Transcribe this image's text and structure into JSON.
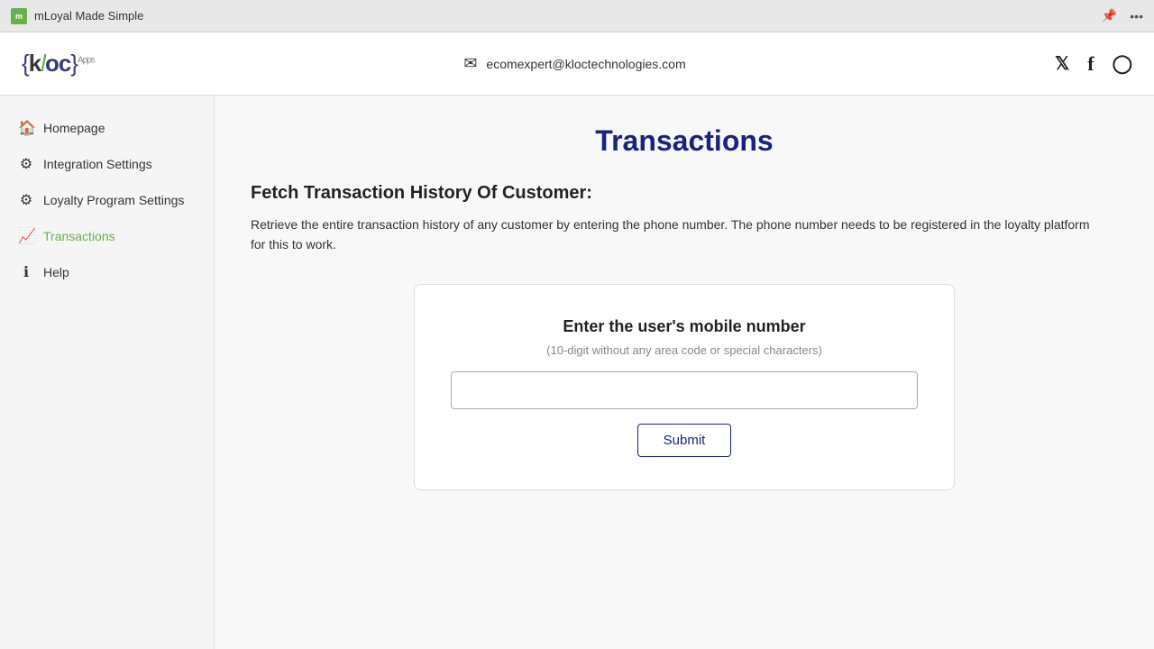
{
  "browser": {
    "tab_title": "mLoyal Made Simple",
    "pin_icon": "📌",
    "more_icon": "⋯"
  },
  "header": {
    "logo_text": "{kloc}",
    "logo_subtitle": "Apps",
    "email_address": "ecomexpert@kloctechnologies.com",
    "social": {
      "twitter": "𝕏",
      "facebook": "f",
      "instagram": "⊙"
    }
  },
  "sidebar": {
    "items": [
      {
        "id": "homepage",
        "label": "Homepage",
        "icon": "🏠",
        "active": false
      },
      {
        "id": "integration-settings",
        "label": "Integration Settings",
        "icon": "⚙",
        "active": false
      },
      {
        "id": "loyalty-program-settings",
        "label": "Loyalty Program Settings",
        "icon": "⚙",
        "active": false
      },
      {
        "id": "transactions",
        "label": "Transactions",
        "icon": "📊",
        "active": true
      },
      {
        "id": "help",
        "label": "Help",
        "icon": "ℹ",
        "active": false
      }
    ]
  },
  "main": {
    "page_title": "Transactions",
    "section_title": "Fetch Transaction History Of Customer:",
    "section_desc": "Retrieve the entire transaction history of any customer by entering the phone number. The phone number needs to be registered in the loyalty platform for this to work.",
    "card": {
      "title": "Enter the user's mobile number",
      "subtitle": "(10-digit without any area code or special characters)",
      "input_placeholder": "",
      "submit_label": "Submit"
    }
  }
}
